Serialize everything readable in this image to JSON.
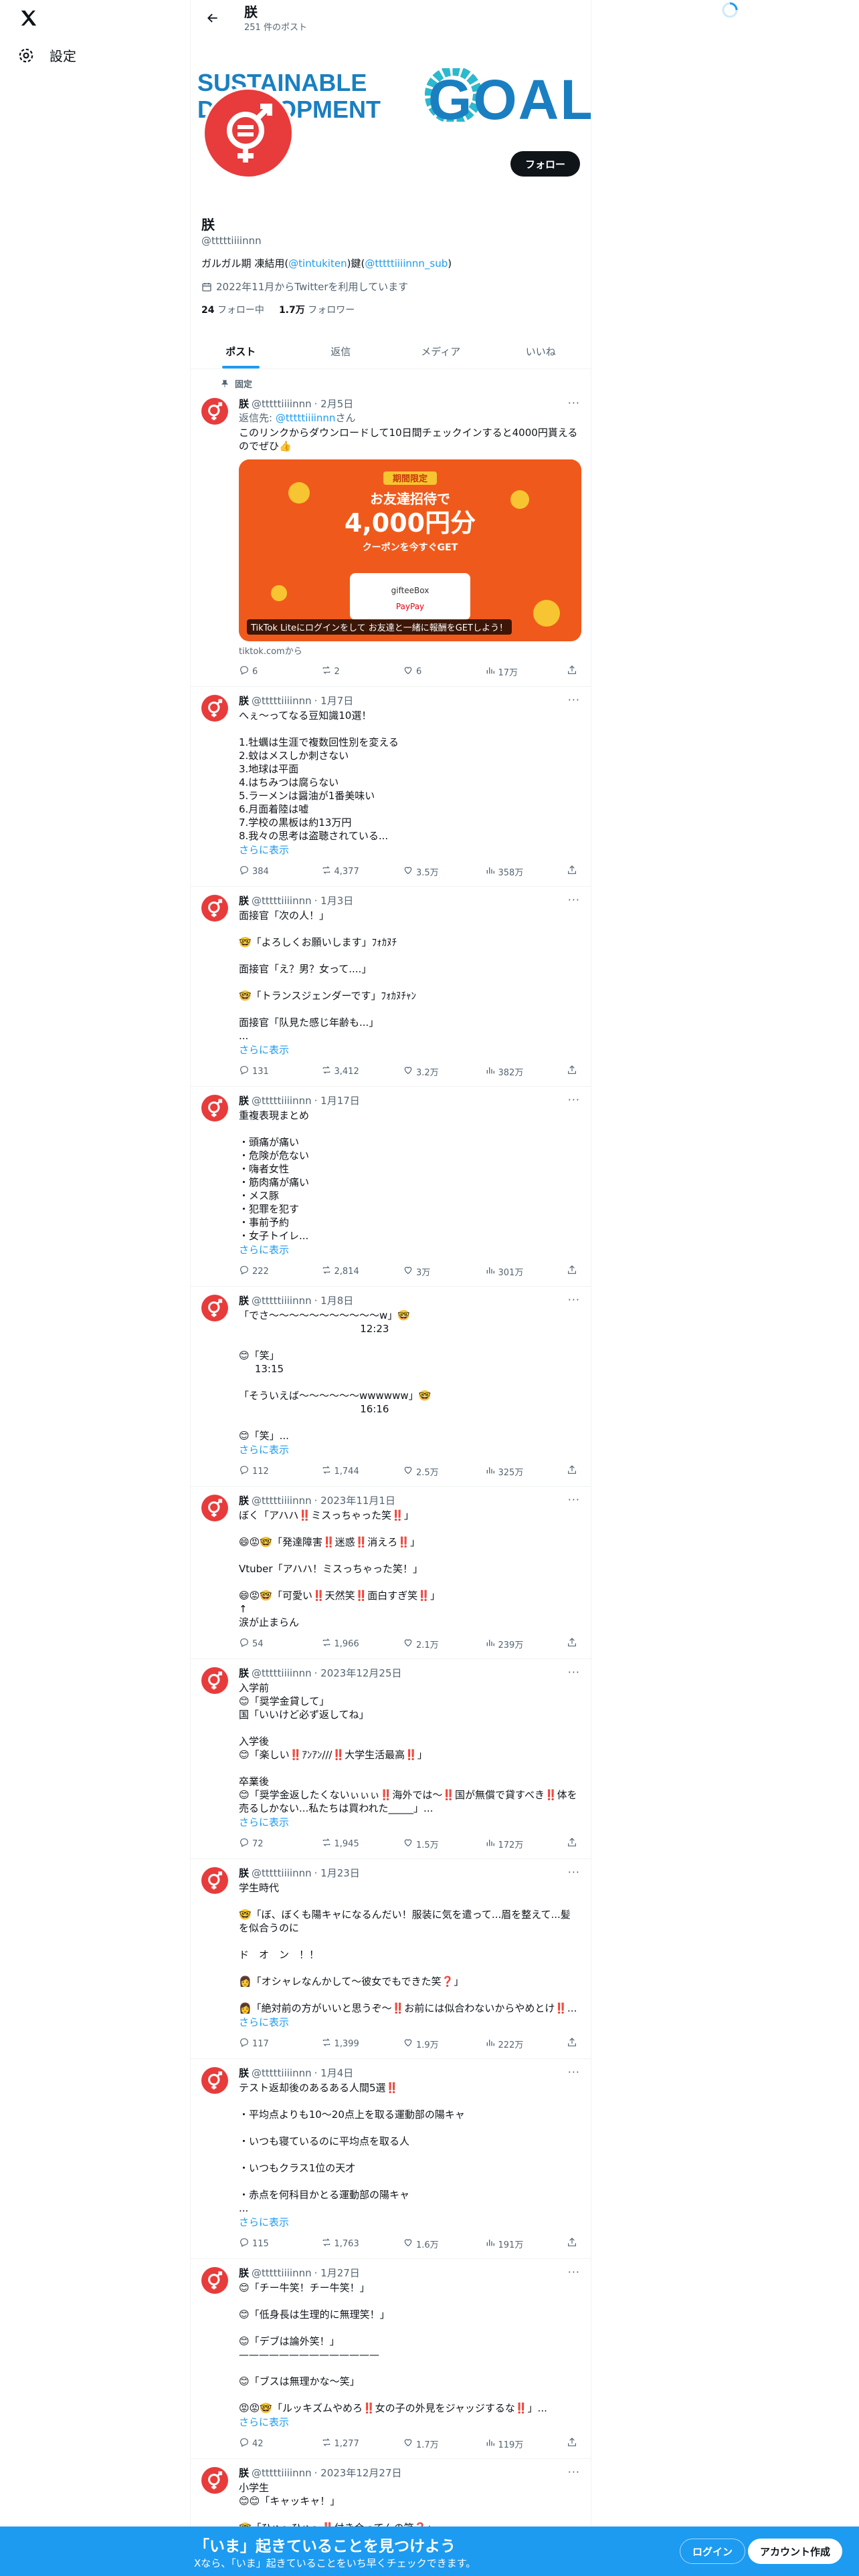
{
  "nav": {
    "settings_label": "設定"
  },
  "header": {
    "name": "朕",
    "post_count": "251 件のポスト"
  },
  "banner": {
    "line1": "SUSTAINABLE",
    "line2": "DEVELOPMENT",
    "goals": "GOALS"
  },
  "profile": {
    "follow_label": "フォロー",
    "name": "朕",
    "handle": "@tttttiiiinnn",
    "bio_prefix": "ガルガル期 凍結用(",
    "bio_link1": "@tintukiten",
    "bio_mid": ")鍵(",
    "bio_link2": "@tttttiiiinnn_sub",
    "bio_suffix": ")",
    "joined": "2022年11月からTwitterを利用しています",
    "following_count": "24",
    "following_label": "フォロー中",
    "followers_count": "1.7万",
    "followers_label": "フォロワー"
  },
  "tabs": [
    "ポスト",
    "返信",
    "メディア",
    "いいね"
  ],
  "pinned_label": "固定",
  "tweets": [
    {
      "name": "朕",
      "handle": "@tttttiiiinnn",
      "date": "· 2月5日",
      "reply_to_prefix": "返信先: ",
      "reply_to_handle": "@tttttiiiinnn",
      "reply_to_suffix": "さん",
      "text": "このリンクからダウンロードして10日間チェックインすると4000円貰えるのでぜひ👍",
      "card_caption": "TikTok Liteにログインをして お友達と一緒に報酬をGETしよう！",
      "card_src": "tiktok.comから",
      "card_badge": "期間限定",
      "card_line1": "お友達招待で",
      "card_line2": "4,000円分",
      "card_line3": "クーポンを今すぐGET",
      "card_brand1": "gifteeBox",
      "card_brand2": "PayPay",
      "replies": "6",
      "reposts": "2",
      "likes": "6",
      "views": "17万"
    },
    {
      "name": "朕",
      "handle": "@tttttiiiinnn",
      "date": "· 1月7日",
      "text": "へぇ〜ってなる豆知識10選！\n\n1.牡蠣は生涯で複数回性別を変える\n2.蚊はメスしか刺さない\n3.地球は平面\n4.はちみつは腐らない\n5.ラーメンは醤油が1番美味い\n6.月面着陸は嘘\n7.学校の黒板は約13万円\n8.我々の思考は盗聴されている...",
      "more": "さらに表示",
      "replies": "384",
      "reposts": "4,377",
      "likes": "3.5万",
      "views": "358万"
    },
    {
      "name": "朕",
      "handle": "@tttttiiiinnn",
      "date": "· 1月3日",
      "text": "面接官「次の人！」\n\n🤓「よろしくお願いします」ﾌｫｶﾇﾁ\n\n面接官「え？男？女って....」\n\n🤓「トランスジェンダーです」ﾌｫｶﾇﾁｬﾝ\n\n面接官「队見た感じ年齢も...」\n...",
      "more": "さらに表示",
      "replies": "131",
      "reposts": "3,412",
      "likes": "3.2万",
      "views": "382万"
    },
    {
      "name": "朕",
      "handle": "@tttttiiiinnn",
      "date": "· 1月17日",
      "text": "重複表現まとめ\n\n・頭痛が痛い\n・危険が危ない\n・嗨者女性\n・筋肉痛が痛い\n・メス豚\n・犯罪を犯す\n・事前予約\n・女子トイレ...",
      "more": "さらに表示",
      "replies": "222",
      "reposts": "2,814",
      "likes": "3万",
      "views": "301万"
    },
    {
      "name": "朕",
      "handle": "@tttttiiiinnn",
      "date": "· 1月8日",
      "text": "「でさ〜〜〜〜〜〜〜〜〜〜〜w」🤓\n                                      12:23\n\n😊「笑」\n     13:15\n\n「そういえば〜〜〜〜〜〜wwwwww」🤓\n                                      16:16\n\n😊「笑」...",
      "more": "さらに表示",
      "replies": "112",
      "reposts": "1,744",
      "likes": "2.5万",
      "views": "325万"
    },
    {
      "name": "朕",
      "handle": "@tttttiiiinnn",
      "date": "· 2023年11月1日",
      "text": "ぼく「アハハ‼️ミスっちゃった笑‼️」\n\n😄😡🤓「発達障害‼️迷惑‼️消えろ‼️」\n\nVtuber「アハハ！ミスっちゃった笑！」\n\n😄😡🤓「可愛い‼️天然笑‼️面白すぎ笑‼️」\n↑\n涙が止まらん",
      "replies": "54",
      "reposts": "1,966",
      "likes": "2.1万",
      "views": "239万"
    },
    {
      "name": "朕",
      "handle": "@tttttiiiinnn",
      "date": "· 2023年12月25日",
      "text": "入学前\n😊「奨学金貸して」\n国「いいけど必ず返してね」\n\n入学後\n😊「楽しい‼️ｱﾝｱﾝ///‼️大学生活最高‼️」\n\n卒業後\n😊「奨学金返したくないぃぃぃ‼️海外では〜‼️国が無償で貸すべき‼️体を売るしかない...私たちは買われた_____」...",
      "more": "さらに表示",
      "replies": "72",
      "reposts": "1,945",
      "likes": "1.5万",
      "views": "172万"
    },
    {
      "name": "朕",
      "handle": "@tttttiiiinnn",
      "date": "· 1月23日",
      "text": "学生時代\n\n🤓「ぼ、ぼくも陽キャになるんだい！服装に気を遣って...眉を整えて...髪を似合うのに\n\nド　オ　ン　！！\n\n👩「オシャレなんかして〜彼女でもできた笑❓」\n\n👩「絶対前の方がいいと思うぞ〜‼️お前には似合わないからやめとけ‼️...",
      "more": "さらに表示",
      "replies": "117",
      "reposts": "1,399",
      "likes": "1.9万",
      "views": "222万"
    },
    {
      "name": "朕",
      "handle": "@tttttiiiinnn",
      "date": "· 1月4日",
      "text": "テスト返却後のあるある人間5選‼️\n\n・平均点よりも10〜20点上を取る運動部の陽キャ\n\n・いつも寝ているのに平均点を取る人\n\n・いつもクラス1位の天才\n\n・赤点を何科目かとる運動部の陽キャ\n...",
      "more": "さらに表示",
      "replies": "115",
      "reposts": "1,763",
      "likes": "1.6万",
      "views": "191万"
    },
    {
      "name": "朕",
      "handle": "@tttttiiiinnn",
      "date": "· 1月27日",
      "text": "😊「チー牛笑！チー牛笑！」\n\n😊「低身長は生理的に無理笑！」\n\n😊「デブは論外笑！」\n——————————————\n\n😊「ブスは無理かな〜笑」\n\n😡😡🤓「ルッキズムやめろ‼️女の子の外見をジャッジするな‼️」...",
      "more": "さらに表示",
      "replies": "42",
      "reposts": "1,277",
      "likes": "1.7万",
      "views": "119万"
    },
    {
      "name": "朕",
      "handle": "@tttttiiiinnn",
      "date": "· 2023年12月27日",
      "text": "小学生\n😊😊「キャッキャ！」\n\n🤓「ひゅ〜ひゅ〜‼️付き合ってんの笑❓」"
    }
  ],
  "bottom": {
    "title": "「いま」起きていることを見つけよう",
    "subtitle": "Xなら、「いま」起きていることをいち早くチェックできます。",
    "login": "ログイン",
    "signup": "アカウント作成"
  },
  "colors": {
    "accent": "#1d9bf0",
    "avatar_bg": "#e83b3b",
    "card_bg": "#ef5a1c"
  }
}
